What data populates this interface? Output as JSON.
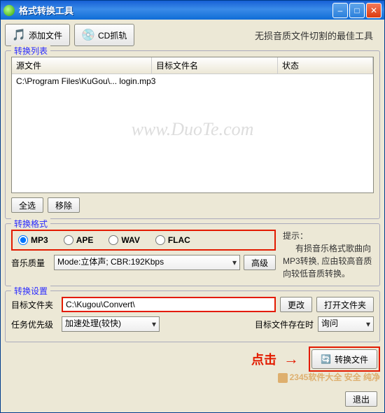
{
  "window": {
    "title": "格式转换工具"
  },
  "toolbar": {
    "add_file": "添加文件",
    "cd_rip": "CD抓轨",
    "tagline": "无损音质文件切割的最佳工具"
  },
  "list": {
    "legend": "转换列表",
    "cols": {
      "source": "源文件",
      "target": "目标文件名",
      "status": "状态"
    },
    "rows": [
      {
        "source": "C:\\Program Files\\KuGou\\... login.mp3",
        "target": "",
        "status": ""
      }
    ],
    "watermark": "www.DuoTe.com",
    "select_all": "全选",
    "remove": "移除"
  },
  "format": {
    "legend": "转换格式",
    "options": [
      "MP3",
      "APE",
      "WAV",
      "FLAC"
    ],
    "selected": "MP3",
    "hint_title": "提示：",
    "hint_body": "有损音乐格式歌曲向MP3转换, 应由较高音质向较低音质转换。",
    "quality_label": "音乐质量",
    "quality_value": "Mode:立体声; CBR:192Kbps",
    "advanced": "高级"
  },
  "settings": {
    "legend": "转换设置",
    "target_folder_label": "目标文件夹",
    "target_folder_value": "C:\\Kugou\\Convert\\",
    "change": "更改",
    "open_folder": "打开文件夹",
    "priority_label": "任务优先级",
    "priority_value": "加速处理(较快)",
    "exists_label": "目标文件存在时",
    "exists_value": "询问"
  },
  "footer": {
    "click_hint": "点击",
    "convert": "转换文件",
    "exit": "退出",
    "corner_watermark": "2345软件大全 安全 纯净"
  }
}
